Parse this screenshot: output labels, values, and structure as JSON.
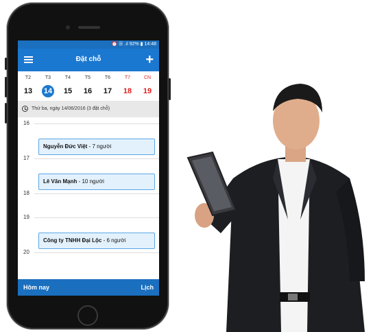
{
  "status_bar": {
    "text": "⏰ ☰ .ıl 92% ▮ 14:48"
  },
  "app_bar": {
    "title": "Đặt chỗ",
    "menu_icon": "hamburger-menu-icon",
    "add_icon": "plus-icon"
  },
  "week": {
    "days": [
      {
        "name": "T2",
        "num": "13",
        "weekend": false,
        "today": false
      },
      {
        "name": "T3",
        "num": "14",
        "weekend": false,
        "today": true
      },
      {
        "name": "T4",
        "num": "15",
        "weekend": false,
        "today": false
      },
      {
        "name": "T5",
        "num": "16",
        "weekend": false,
        "today": false
      },
      {
        "name": "T6",
        "num": "17",
        "weekend": false,
        "today": false
      },
      {
        "name": "T7",
        "num": "18",
        "weekend": true,
        "today": false
      },
      {
        "name": "CN",
        "num": "19",
        "weekend": true,
        "today": false
      }
    ]
  },
  "date_line": {
    "text": "Thứ ba, ngày 14/06/2016 (3 đặt chỗ)"
  },
  "timeline": {
    "hours": [
      "16",
      "17",
      "18",
      "19",
      "20"
    ],
    "events": [
      {
        "name": "Nguyễn Đức Việt",
        "detail": " - 7 người"
      },
      {
        "name": "Lê Văn Mạnh",
        "detail": " - 10 người"
      },
      {
        "name": "Công ty TNHH Đại Lộc",
        "detail": " - 6 người"
      }
    ]
  },
  "bottom_bar": {
    "today": "Hôm nay",
    "calendar": "Lịch"
  },
  "colors": {
    "primary": "#1b78d0",
    "weekend": "#e02020",
    "event_bg": "#e3f1fc"
  }
}
